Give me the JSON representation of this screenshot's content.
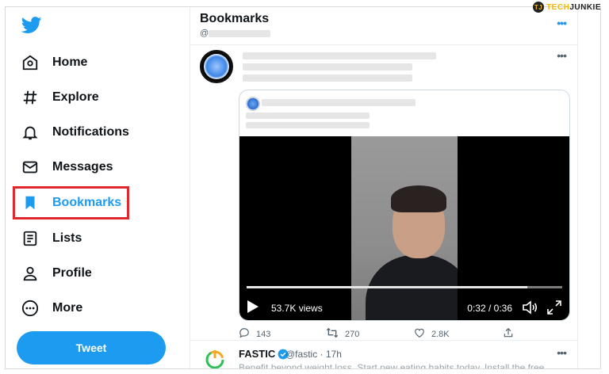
{
  "watermark": {
    "tech": "TECH",
    "junkie": "JUNKIE"
  },
  "sidebar": {
    "items": [
      {
        "label": "Home",
        "icon": "home-icon"
      },
      {
        "label": "Explore",
        "icon": "hashtag-icon"
      },
      {
        "label": "Notifications",
        "icon": "bell-icon"
      },
      {
        "label": "Messages",
        "icon": "envelope-icon"
      },
      {
        "label": "Bookmarks",
        "icon": "bookmark-icon",
        "active": true
      },
      {
        "label": "Lists",
        "icon": "list-icon"
      },
      {
        "label": "Profile",
        "icon": "person-icon"
      },
      {
        "label": "More",
        "icon": "more-circle-icon"
      }
    ],
    "tweet_button": "Tweet"
  },
  "header": {
    "title": "Bookmarks",
    "handle_prefix": "@"
  },
  "tweet": {
    "video": {
      "views": "53.7K views",
      "time": "0:32 / 0:36",
      "progress": 0.89
    },
    "actions": {
      "replies": "143",
      "retweets": "270",
      "likes": "2.8K"
    }
  },
  "tweet2": {
    "name": "FASTIC",
    "meta": "@fastic · 17h",
    "text": "Benefit beyond weight loss. Start new eating habits today. Install the free..."
  },
  "colors": {
    "accent": "#1d9bf0",
    "highlight": "#e0262f",
    "text": "#0f1419",
    "muted": "#536471"
  }
}
